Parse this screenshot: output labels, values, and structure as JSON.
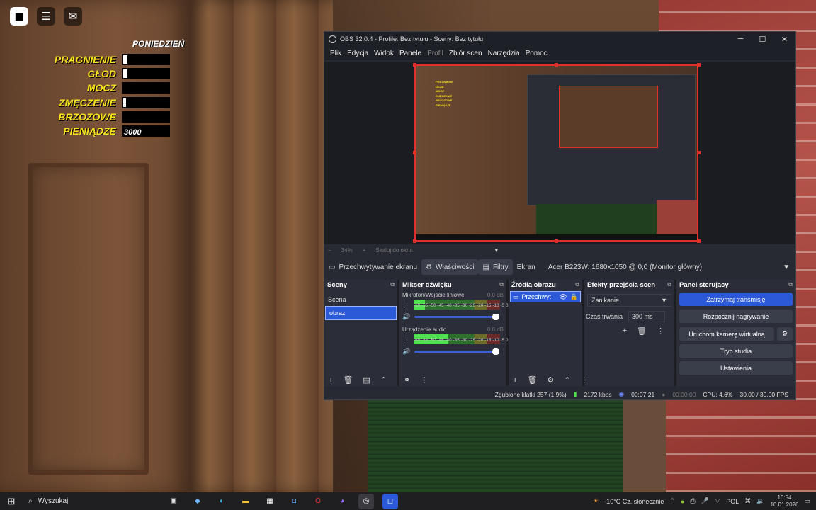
{
  "hud": {
    "day": "PONIEDZIEŃ",
    "stats": [
      {
        "label": "PRAGNIENIE",
        "level": 0.1
      },
      {
        "label": "GŁOD",
        "level": 0.1
      },
      {
        "label": "MOCZ",
        "level": 0
      },
      {
        "label": "ZMĘCZENIE",
        "level": 0.06
      },
      {
        "label": "BRZOZOWE",
        "level": 0
      },
      {
        "label": "PIENIĄDZE",
        "value": "3000"
      }
    ]
  },
  "obs": {
    "title": "OBS 32.0.4 - Profile: Bez tytułu - Sceny: Bez tytułu",
    "menu": [
      "Plik",
      "Edycja",
      "Widok",
      "Panele",
      "Profil",
      "Zbiór scen",
      "Narzędzia",
      "Pomoc"
    ],
    "zoom": {
      "percent": "34%",
      "fit": "Skaluj do okna"
    },
    "source_bar": {
      "source_name": "Przechwytywanie ekranu",
      "properties": "Właściwości",
      "filters": "Filtry",
      "screen_label": "Ekran",
      "screen_value": "Acer B223W: 1680x1050 @ 0,0 (Monitor główny)"
    },
    "scenes": {
      "title": "Sceny",
      "items": [
        {
          "name": "Scena",
          "active": false
        },
        {
          "name": "obraz",
          "active": true
        }
      ]
    },
    "mixer": {
      "title": "Mikser dźwięku",
      "ticks": "-60 -55 -50 -45 -40 -35 -30 -25 -20 -15 -10 -5 0",
      "channels": [
        {
          "name": "Mikrofon/Wejście liniowe",
          "db": "0.0 dB",
          "level": 0.13
        },
        {
          "name": "Urządzenie audio",
          "db": "0.0 dB",
          "level": 0.4
        }
      ]
    },
    "sources": {
      "title": "Źródła obrazu",
      "items": [
        {
          "name": "Przechwyt"
        }
      ]
    },
    "transitions": {
      "title": "Efekty przejścia scen",
      "selected": "Zanikanie",
      "duration_label": "Czas trwania",
      "duration_value": "300 ms"
    },
    "controls": {
      "title": "Panel sterujący",
      "stop_stream": "Zatrzymaj transmisję",
      "start_record": "Rozpocznij nagrywanie",
      "virtual_cam": "Uruchom kamerę wirtualną",
      "studio_mode": "Tryb studia",
      "settings": "Ustawienia"
    },
    "status": {
      "dropped": "Zgubione klatki 257 (1.9%)",
      "bitrate": "2172 kbps",
      "stream_time": "00:07:21",
      "rec_time": "00:00:00",
      "cpu": "CPU: 4.6%",
      "fps": "30.00 / 30.00 FPS"
    },
    "preview_hud": [
      "PRAGNIENIE",
      "GŁOD",
      "MOCZ",
      "ZMĘCZENIE",
      "BRZOZOWE",
      "PIENIĄDZE"
    ]
  },
  "taskbar": {
    "search": "Wyszukaj",
    "weather": "-10°C  Cz. słonecznie",
    "lang": "POL",
    "time": "10:54",
    "date": "10.01.2026"
  }
}
